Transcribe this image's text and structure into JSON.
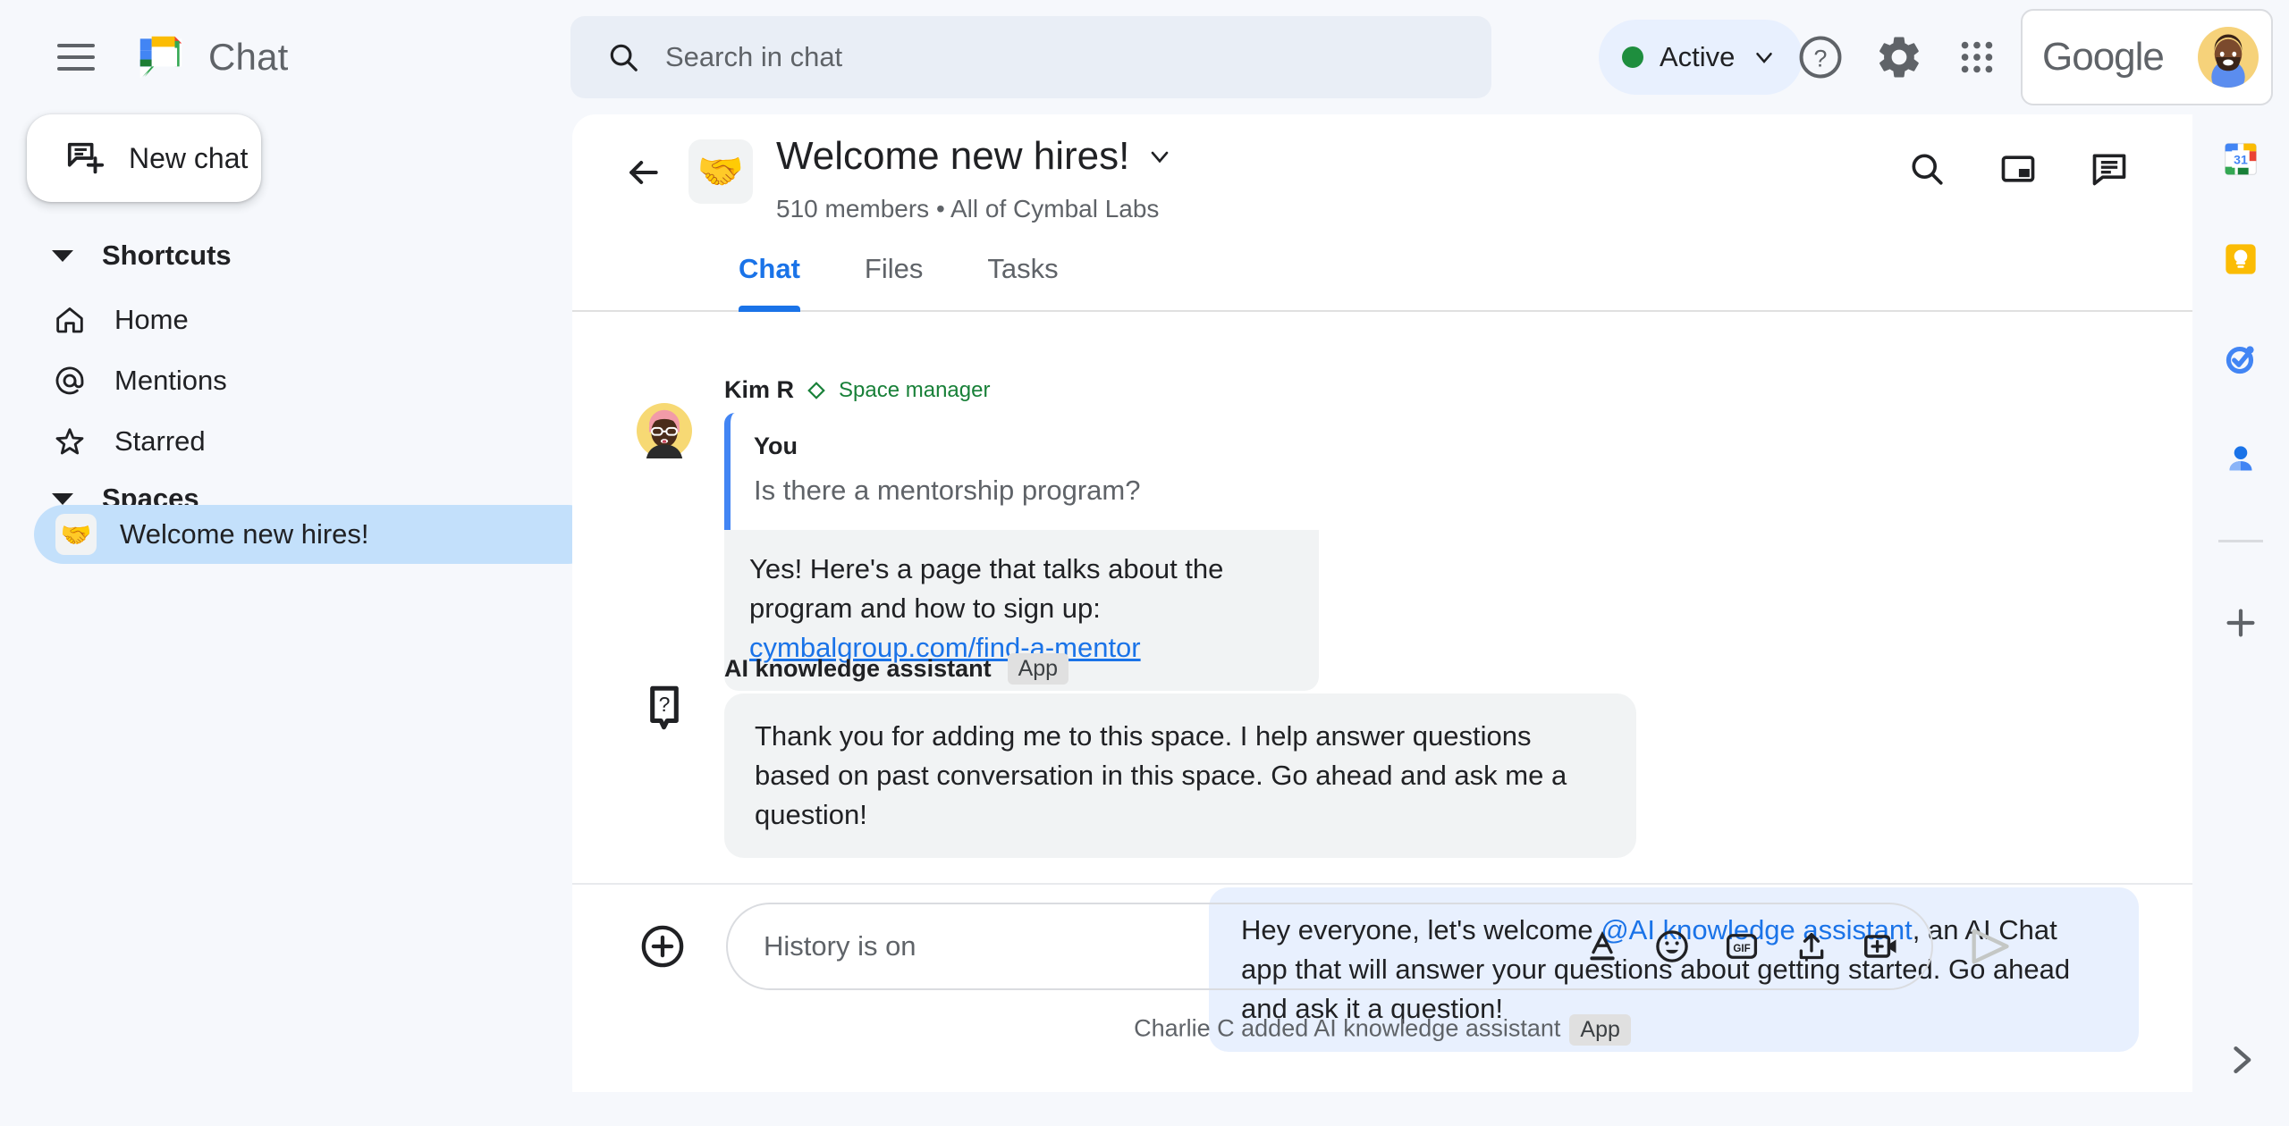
{
  "topbar": {
    "menu_icon": "hamburger-menu-icon",
    "brand_name": "Chat",
    "brand_logo_icon": "google-chat-logo-icon",
    "search": {
      "placeholder": "Search in chat",
      "icon": "search-icon"
    },
    "status": {
      "label": "Active",
      "color": "#1e8e3e",
      "chevron_icon": "chevron-down-icon"
    },
    "help_icon": "help-circle-icon",
    "settings_icon": "gear-icon",
    "apps_icon": "apps-grid-icon",
    "account": {
      "word": "Google",
      "avatar_icon": "user-avatar"
    }
  },
  "sidebar": {
    "new_chat": {
      "label": "New chat",
      "icon": "new-chat-icon"
    },
    "shortcuts": {
      "title": "Shortcuts",
      "items": [
        {
          "label": "Home",
          "icon": "home-icon"
        },
        {
          "label": "Mentions",
          "icon": "at-mention-icon"
        },
        {
          "label": "Starred",
          "icon": "star-icon"
        }
      ]
    },
    "spaces": {
      "title": "Spaces",
      "items": [
        {
          "label": "Welcome new hires!",
          "emoji": "🤝",
          "selected": true
        }
      ]
    }
  },
  "space": {
    "back_icon": "back-arrow-icon",
    "emoji": "🤝",
    "title": "Welcome new hires!",
    "title_chevron_icon": "chevron-down-icon",
    "members": "510 members",
    "separator": "•",
    "org": "All of Cymbal Labs",
    "subtitle": "510 members  •  All of Cymbal Labs",
    "actions": [
      {
        "icon": "search-icon",
        "name": "search-in-space"
      },
      {
        "icon": "picture-in-picture-icon",
        "name": "open-in-pip"
      },
      {
        "icon": "thread-panel-icon",
        "name": "toggle-threads"
      }
    ],
    "tabs": [
      {
        "label": "Chat",
        "active": true
      },
      {
        "label": "Files",
        "active": false
      },
      {
        "label": "Tasks",
        "active": false
      }
    ]
  },
  "messages": {
    "kim": {
      "sender": "Kim R",
      "badge": "Space manager",
      "badge_icon": "diamond-icon",
      "quote": {
        "who": "You",
        "text": "Is there a mentorship program?"
      },
      "reply_text": "Yes! Here's a page that talks about the program and how to sign up: ",
      "reply_link": "cymbalgroup.com/find-a-mentor"
    },
    "outgoing": {
      "text_before": "Hey everyone, let's welcome ",
      "mention": "@AI knowledge assistant",
      "text_after": ", an AI Chat app that will answer your questions about getting started.  Go ahead and ask it a question!"
    },
    "system": {
      "text": "Charlie C added AI knowledge assistant",
      "badge": "App"
    },
    "bot": {
      "sender": "AI knowledge assistant",
      "badge": "App",
      "icon": "question-bubble-icon",
      "text": "Thank you for adding me to this space. I help answer questions based on past conversation in this space. Go ahead and ask me a question!"
    }
  },
  "composer": {
    "plus_icon": "add-circle-icon",
    "placeholder": "History is on",
    "icons": [
      {
        "icon": "format-text-icon",
        "name": "format-button"
      },
      {
        "icon": "emoji-icon",
        "name": "emoji-button"
      },
      {
        "icon": "gif-icon",
        "name": "gif-button",
        "label": "GIF"
      },
      {
        "icon": "upload-icon",
        "name": "upload-button"
      },
      {
        "icon": "video-add-icon",
        "name": "video-meeting-button"
      }
    ],
    "send_icon": "send-icon"
  },
  "rail": {
    "items": [
      {
        "icon": "google-calendar-icon",
        "name": "calendar",
        "label": "31"
      },
      {
        "icon": "google-keep-icon",
        "name": "keep"
      },
      {
        "icon": "google-tasks-icon",
        "name": "tasks"
      },
      {
        "icon": "google-contacts-icon",
        "name": "contacts"
      }
    ],
    "add_icon": "plus-icon",
    "expand_icon": "chevron-right-icon"
  },
  "colors": {
    "page_bg": "#f6f8fc",
    "panel_bg": "#ffffff",
    "accent_blue": "#1a73e8",
    "bubble_blue": "#e8f0fe",
    "bubble_gray": "#f1f3f4",
    "selected_space": "#c3e0fb",
    "status_green": "#1e8e3e"
  }
}
